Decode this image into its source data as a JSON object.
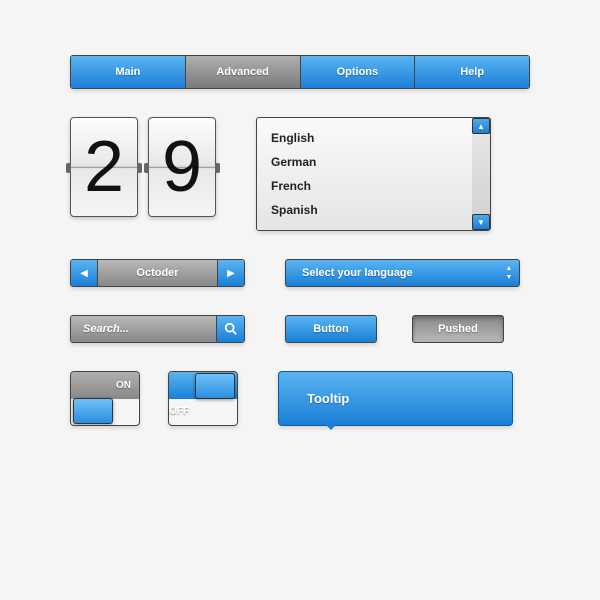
{
  "tabs": [
    "Main",
    "Advanced",
    "Options",
    "Help"
  ],
  "tabs_active_index": 1,
  "flip": {
    "d1": "2",
    "d2": "9"
  },
  "languages": [
    "English",
    "German",
    "French",
    "Spanish"
  ],
  "spinner": {
    "value": "Octoder"
  },
  "dropdown": {
    "label": "Select your language"
  },
  "search": {
    "placeholder": "Search..."
  },
  "buttons": {
    "normal": "Button",
    "pushed": "Pushed"
  },
  "toggle": {
    "on": "ON",
    "off": "OFF"
  },
  "tooltip": {
    "text": "Tooltip"
  },
  "colors": {
    "blue_light": "#5ab4f2",
    "blue_dark": "#1a7fd6",
    "gray_light": "#b8b8b8",
    "gray_dark": "#888"
  }
}
